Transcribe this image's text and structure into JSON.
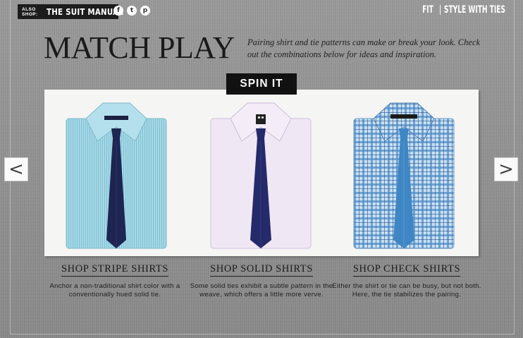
{
  "header": {
    "also_shop_small": "ALSO SHOP:",
    "also_shop_brand": "THE SUIT MANUAL",
    "social": {
      "facebook": "f",
      "twitter": "t",
      "pinterest": "p"
    },
    "nav": {
      "fit": "FIT",
      "style_with_ties": "STYLE WITH TIES"
    }
  },
  "hero": {
    "title": "MATCH PLAY",
    "subtitle": "Pairing shirt and tie patterns can make or break your look. Check out the combinations below for ideas and inspiration."
  },
  "carousel": {
    "spin_label": "SPIN IT",
    "prev_label": "<",
    "next_label": ">"
  },
  "shirts": [
    {
      "shop_label": "SHOP STRIPE SHIRTS",
      "description": "Anchor a non-traditional shirt color with a conventionally hued solid tie."
    },
    {
      "shop_label": "SHOP SOLID SHIRTS",
      "description": "Some solid ties exhibit a subtle pattern in the weave, which offers a little more verve."
    },
    {
      "shop_label": "SHOP CHECK SHIRTS",
      "description": "Either the shirt or tie can be busy, but not both. Here, the tie stabilizes the pairing."
    }
  ],
  "colors": {
    "stripe_shirt": "#9fd3e1",
    "solid_shirt": "#ece4f2",
    "check_shirt": "#b9d8ef",
    "navy_tie": "#1d2550",
    "indigo_tie": "#252a6a",
    "blue_tie": "#3f86c4"
  }
}
